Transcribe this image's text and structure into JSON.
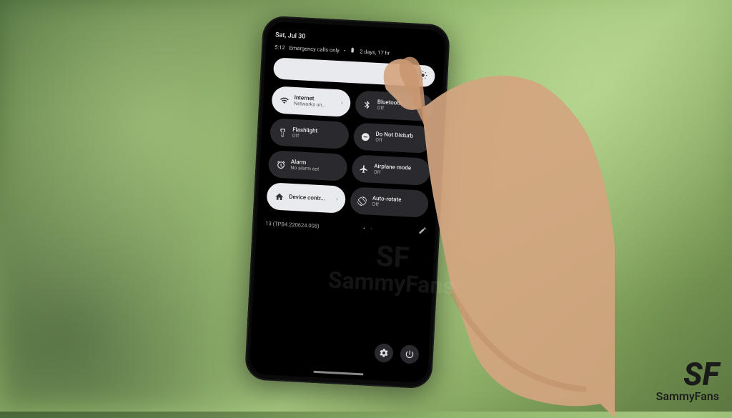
{
  "status": {
    "date": "Sat, Jul 30",
    "time": "5:12",
    "network": "Emergency calls only",
    "battery": "2 days, 17 hr"
  },
  "tiles": [
    {
      "icon": "wifi-icon",
      "title": "Internet",
      "sub": "Networks un...",
      "light": true,
      "chevron": true
    },
    {
      "icon": "bluetooth-icon",
      "title": "Bluetooth",
      "sub": "Off",
      "light": false
    },
    {
      "icon": "flashlight-icon",
      "title": "Flashlight",
      "sub": "Off",
      "light": false
    },
    {
      "icon": "dnd-icon",
      "title": "Do Not Disturb",
      "sub": "Off",
      "light": false
    },
    {
      "icon": "alarm-icon",
      "title": "Alarm",
      "sub": "No alarm set",
      "light": false
    },
    {
      "icon": "airplane-icon",
      "title": "Airplane mode",
      "sub": "Off",
      "light": false
    },
    {
      "icon": "home-icon",
      "title": "Device contr...",
      "sub": "",
      "light": true,
      "chevron": true
    },
    {
      "icon": "rotate-icon",
      "title": "Auto-rotate",
      "sub": "Off",
      "light": false
    }
  ],
  "build": "13 (TPB4.220624.008)",
  "watermark": {
    "logo": "SF",
    "name": "SammyFans"
  }
}
